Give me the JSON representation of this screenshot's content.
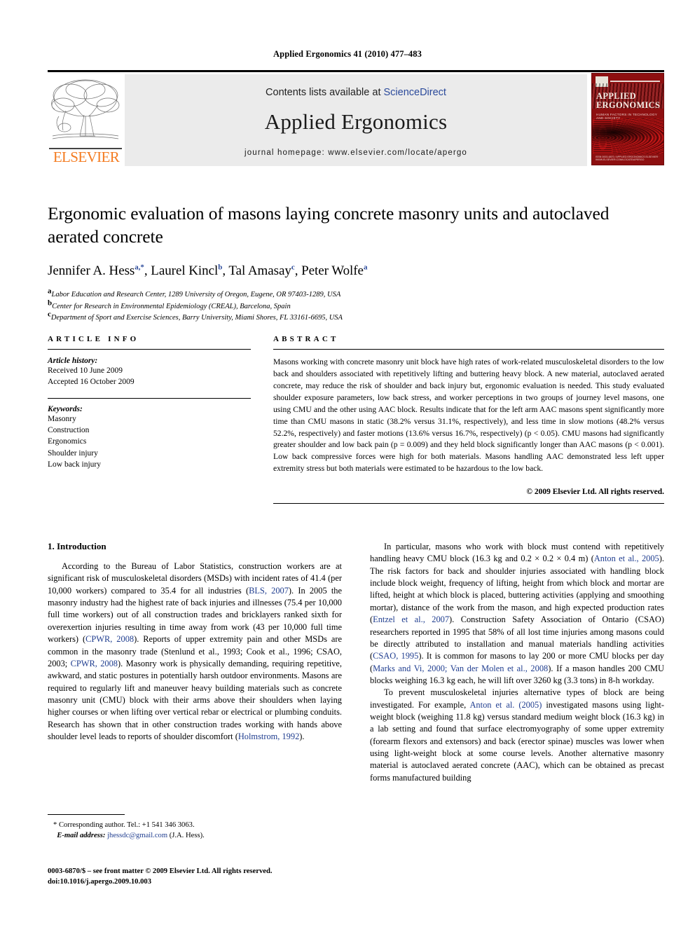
{
  "running_head": "Applied Ergonomics 41 (2010) 477–483",
  "masthead": {
    "publisher_name": "ELSEVIER",
    "contents_prefix": "Contents lists available at",
    "contents_link": "ScienceDirect",
    "journal_title": "Applied Ergonomics",
    "homepage": "journal homepage: www.elsevier.com/locate/apergo",
    "cover": {
      "title_line1": "APPLIED",
      "title_line2": "ERGONOMICS",
      "subtitle": "HUMAN FACTORS IN TECHNOLOGY AND SOCIETY",
      "footer": "ISSN 0003-6870 / APPLIED ERGONOMICS\nELSEVIER · WWW.ELSEVIER.COM/LOCATE/APERGO"
    }
  },
  "article": {
    "title": "Ergonomic evaluation of masons laying concrete masonry units and autoclaved aerated concrete",
    "authors": [
      {
        "name": "Jennifer A. Hess",
        "marks": "a,*"
      },
      {
        "name": "Laurel Kincl",
        "marks": "b"
      },
      {
        "name": "Tal Amasay",
        "marks": "c"
      },
      {
        "name": "Peter Wolfe",
        "marks": "a"
      }
    ],
    "affiliations": [
      {
        "mark": "a",
        "text": "Labor Education and Research Center, 1289 University of Oregon, Eugene, OR 97403-1289, USA"
      },
      {
        "mark": "b",
        "text": "Center for Research in Environmental Epidemiology (CREAL), Barcelona, Spain"
      },
      {
        "mark": "c",
        "text": "Department of Sport and Exercise Sciences, Barry University, Miami Shores, FL 33161-6695, USA"
      }
    ]
  },
  "article_info": {
    "heading": "ARTICLE INFO",
    "history_label": "Article history:",
    "history": [
      "Received 10 June 2009",
      "Accepted 16 October 2009"
    ],
    "keywords_label": "Keywords:",
    "keywords": [
      "Masonry",
      "Construction",
      "Ergonomics",
      "Shoulder injury",
      "Low back injury"
    ]
  },
  "abstract": {
    "heading": "ABSTRACT",
    "text": "Masons working with concrete masonry unit block have high rates of work-related musculoskeletal disorders to the low back and shoulders associated with repetitively lifting and buttering heavy block. A new material, autoclaved aerated concrete, may reduce the risk of shoulder and back injury but, ergonomic evaluation is needed. This study evaluated shoulder exposure parameters, low back stress, and worker perceptions in two groups of journey level masons, one using CMU and the other using AAC block. Results indicate that for the left arm AAC masons spent significantly more time than CMU masons in static (38.2% versus 31.1%, respectively), and less time in slow motions (48.2% versus 52.2%, respectively) and faster motions (13.6% versus 16.7%, respectively) (p < 0.05). CMU masons had significantly greater shoulder and low back pain (p = 0.009) and they held block significantly longer than AAC masons (p < 0.001). Low back compressive forces were high for both materials. Masons handling AAC demonstrated less left upper extremity stress but both materials were estimated to be hazardous to the low back.",
    "copyright": "© 2009 Elsevier Ltd. All rights reserved."
  },
  "body": {
    "section_number_title": "1. Introduction",
    "left_paragraphs": [
      "According to the Bureau of Labor Statistics, construction workers are at significant risk of musculoskeletal disorders (MSDs) with incident rates of 41.4 (per 10,000 workers) compared to 35.4 for all industries (BLS, 2007). In 2005 the masonry industry had the highest rate of back injuries and illnesses (75.4 per 10,000 full time workers) out of all construction trades and bricklayers ranked sixth for overexertion injuries resulting in time away from work (43 per 10,000 full time workers) (CPWR, 2008). Reports of upper extremity pain and other MSDs are common in the masonry trade (Stenlund et al., 1993; Cook et al., 1996; CSAO, 2003; CPWR, 2008). Masonry work is physically demanding, requiring repetitive, awkward, and static postures in potentially harsh outdoor environments. Masons are required to regularly lift and maneuver heavy building materials such as concrete masonry unit (CMU) block with their arms above their shoulders when laying higher courses or when lifting over vertical rebar or electrical or plumbing conduits. Research has shown that in other construction trades working with hands above shoulder level leads to reports of shoulder discomfort (Holmstrom, 1992)."
    ],
    "right_paragraphs": [
      "In particular, masons who work with block must contend with repetitively handling heavy CMU block (16.3 kg and 0.2 × 0.2 × 0.4 m) (Anton et al., 2005). The risk factors for back and shoulder injuries associated with handling block include block weight, frequency of lifting, height from which block and mortar are lifted, height at which block is placed, buttering activities (applying and smoothing mortar), distance of the work from the mason, and high expected production rates (Entzel et al., 2007). Construction Safety Association of Ontario (CSAO) researchers reported in 1995 that 58% of all lost time injuries among masons could be directly attributed to installation and manual materials handling activities (CSAO, 1995). It is common for masons to lay 200 or more CMU blocks per day (Marks and Vi, 2000; Van der Molen et al., 2008). If a mason handles 200 CMU blocks weighing 16.3 kg each, he will lift over 3260 kg (3.3 tons) in 8-h workday.",
      "To prevent musculoskeletal injuries alternative types of block are being investigated. For example, Anton et al. (2005) investigated masons using light-weight block (weighing 11.8 kg) versus standard medium weight block (16.3 kg) in a lab setting and found that surface electromyography of some upper extremity (forearm flexors and extensors) and back (erector spinae) muscles was lower when using light-weight block at some course levels. Another alternative masonry material is autoclaved aerated concrete (AAC), which can be obtained as precast forms manufactured building"
    ]
  },
  "footnote": {
    "corresponding": "* Corresponding author. Tel.: +1 541 346 3063.",
    "email_label": "E-mail address:",
    "email": "jhessdc@gmail.com",
    "email_suffix": "(J.A. Hess)."
  },
  "imprint": {
    "line1": "0003-6870/$ – see front matter © 2009 Elsevier Ltd. All rights reserved.",
    "line2": "doi:10.1016/j.apergo.2009.10.003"
  },
  "colors": {
    "link": "#1f3d8f",
    "elsevier_orange": "#F47B20",
    "band_gray": "#ebebeb",
    "cover_red": "#8d0f10"
  }
}
